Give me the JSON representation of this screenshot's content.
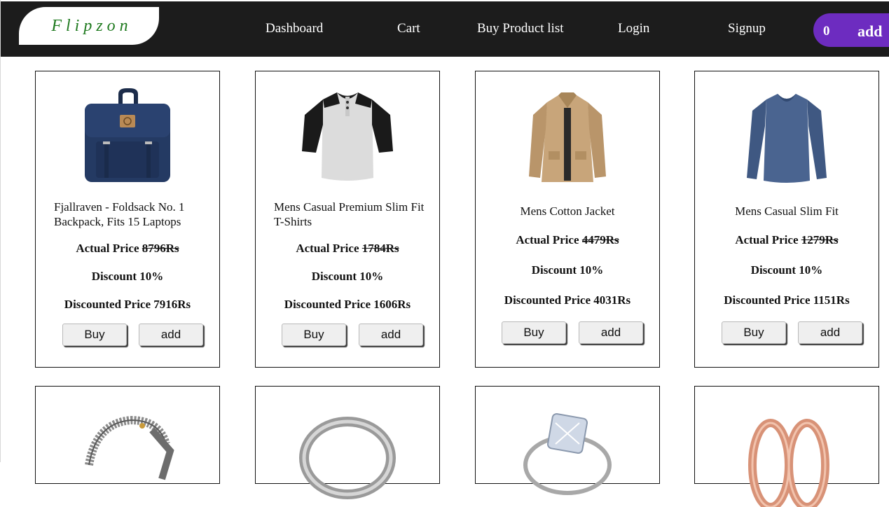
{
  "brand": {
    "logo_text": "Flipzon"
  },
  "nav": {
    "dashboard": "Dashboard",
    "cart": "Cart",
    "buy_product_list": "Buy Product list",
    "login": "Login",
    "signup": "Signup"
  },
  "cart_badge": {
    "count": "0",
    "label": "add"
  },
  "labels": {
    "actual_price": "Actual Price",
    "discount": "Discount",
    "discounted_price": "Discounted Price",
    "buy": "Buy",
    "add": "add"
  },
  "products": [
    {
      "title": "Fjallraven - Foldsack No. 1 Backpack, Fits 15 Laptops",
      "actual_price": "8796Rs",
      "discount": "10%",
      "discounted_price": "7916Rs",
      "image": "backpack-image"
    },
    {
      "title": "Mens Casual Premium Slim Fit T-Shirts",
      "actual_price": "1784Rs",
      "discount": "10%",
      "discounted_price": "1606Rs",
      "image": "raglan-tshirt-image"
    },
    {
      "title": "Mens Cotton Jacket",
      "actual_price": "4479Rs",
      "discount": "10%",
      "discounted_price": "4031Rs",
      "image": "cotton-jacket-image"
    },
    {
      "title": "Mens Casual Slim Fit",
      "actual_price": "1279Rs",
      "discount": "10%",
      "discounted_price": "1151Rs",
      "image": "slim-fit-shirt-image"
    },
    {
      "image": "dragon-bracelet-image"
    },
    {
      "image": "silver-ring-image"
    },
    {
      "image": "diamond-ring-image"
    },
    {
      "image": "rose-gold-rings-image"
    }
  ],
  "colors": {
    "nav_bg": "#1c1c1c",
    "badge_bg": "#6d2cc0",
    "logo_text": "#1f7a1f"
  }
}
